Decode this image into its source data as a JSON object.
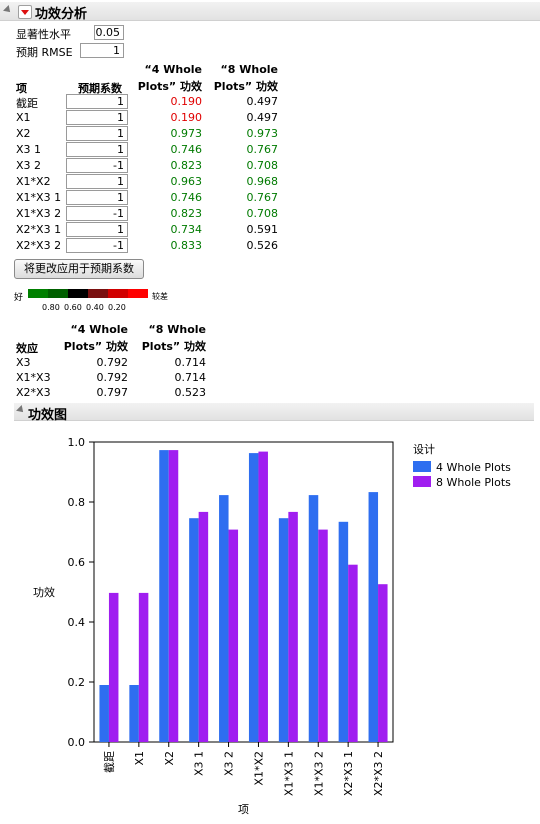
{
  "panel": {
    "title": "功效分析"
  },
  "params": {
    "sig_label": "显著性水平",
    "sig_value": "0.05",
    "rmse_label": "预期 RMSE",
    "rmse_value": "1"
  },
  "table": {
    "col_term": "项",
    "col_coef": "预期系数",
    "col_4_line1": "“4 Whole",
    "col_4_line2": "Plots” 功效",
    "col_8_line1": "“8 Whole",
    "col_8_line2": "Plots” 功效",
    "rows": [
      {
        "term": "截距",
        "coef": "1",
        "p4": "0.190",
        "p8": "0.497",
        "c4": "red",
        "c8": "blk"
      },
      {
        "term": "X1",
        "coef": "1",
        "p4": "0.190",
        "p8": "0.497",
        "c4": "red",
        "c8": "blk"
      },
      {
        "term": "X2",
        "coef": "1",
        "p4": "0.973",
        "p8": "0.973",
        "c4": "green",
        "c8": "green"
      },
      {
        "term": "X3 1",
        "coef": "1",
        "p4": "0.746",
        "p8": "0.767",
        "c4": "green",
        "c8": "green"
      },
      {
        "term": "X3 2",
        "coef": "-1",
        "p4": "0.823",
        "p8": "0.708",
        "c4": "green",
        "c8": "green"
      },
      {
        "term": "X1*X2",
        "coef": "1",
        "p4": "0.963",
        "p8": "0.968",
        "c4": "green",
        "c8": "green"
      },
      {
        "term": "X1*X3 1",
        "coef": "1",
        "p4": "0.746",
        "p8": "0.767",
        "c4": "green",
        "c8": "green"
      },
      {
        "term": "X1*X3 2",
        "coef": "-1",
        "p4": "0.823",
        "p8": "0.708",
        "c4": "green",
        "c8": "green"
      },
      {
        "term": "X2*X3 1",
        "coef": "1",
        "p4": "0.734",
        "p8": "0.591",
        "c4": "green",
        "c8": "blk"
      },
      {
        "term": "X2*X3 2",
        "coef": "-1",
        "p4": "0.833",
        "p8": "0.526",
        "c4": "green",
        "c8": "blk"
      }
    ]
  },
  "apply_button": "将更改应用于预期系数",
  "legend_bar": {
    "good": "好",
    "bad": "较差",
    "ticks": [
      "0.80",
      "0.60",
      "0.40",
      "0.20"
    ],
    "colors": [
      "#008000",
      "#006000",
      "#000000",
      "#7a1010",
      "#d10000",
      "#ff0000"
    ]
  },
  "effects": {
    "col_effect": "效应",
    "col_4_line1": "“4 Whole",
    "col_4_line2": "Plots” 功效",
    "col_8_line1": "“8 Whole",
    "col_8_line2": "Plots” 功效",
    "rows": [
      {
        "effect": "X3",
        "p4": "0.792",
        "p8": "0.714"
      },
      {
        "effect": "X1*X3",
        "p4": "0.792",
        "p8": "0.714"
      },
      {
        "effect": "X2*X3",
        "p4": "0.797",
        "p8": "0.523"
      }
    ]
  },
  "plot_panel": {
    "title": "功效图"
  },
  "chart_data": {
    "type": "bar",
    "categories": [
      "截距",
      "X1",
      "X2",
      "X3 1",
      "X3 2",
      "X1*X2",
      "X1*X3 1",
      "X1*X3 2",
      "X2*X3 1",
      "X2*X3 2"
    ],
    "series": [
      {
        "name": "4 Whole Plots",
        "color": "#2e6ef0",
        "values": [
          0.19,
          0.19,
          0.973,
          0.746,
          0.823,
          0.963,
          0.746,
          0.823,
          0.734,
          0.833
        ]
      },
      {
        "name": "8 Whole Plots",
        "color": "#a01ef0",
        "values": [
          0.497,
          0.497,
          0.973,
          0.767,
          0.708,
          0.968,
          0.767,
          0.708,
          0.591,
          0.526
        ]
      }
    ],
    "ylim": [
      0,
      1.0
    ],
    "yticks": [
      "0.0",
      "0.2",
      "0.4",
      "0.6",
      "0.8",
      "1.0"
    ],
    "xlabel": "项",
    "ylabel": "功效",
    "legend_title": "设计",
    "legend_position": "top-right",
    "grid": false
  }
}
